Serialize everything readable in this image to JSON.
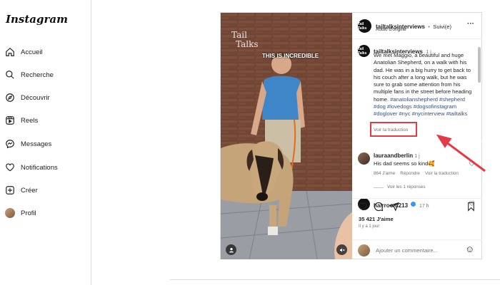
{
  "app": {
    "logo": "Instagram"
  },
  "nav": [
    {
      "label": "Accueil",
      "icon": "home-icon"
    },
    {
      "label": "Recherche",
      "icon": "search-icon"
    },
    {
      "label": "Découvrir",
      "icon": "compass-icon"
    },
    {
      "label": "Reels",
      "icon": "reels-icon"
    },
    {
      "label": "Messages",
      "icon": "messenger-icon"
    },
    {
      "label": "Notifications",
      "icon": "heart-icon"
    },
    {
      "label": "Créer",
      "icon": "plus-square-icon"
    },
    {
      "label": "Profil",
      "icon": "profile-avatar"
    }
  ],
  "media": {
    "watermark_line1": "Tail",
    "watermark_line2": "Talks",
    "overlay_text": "THIS IS INCREDIBLE"
  },
  "post_header": {
    "avatar_text": "Tail Talks",
    "username": "tailtalksinterviews",
    "separator": "•",
    "follow_status": "Suivi(e)",
    "audio": "Audio d'origine",
    "more": "···"
  },
  "caption": {
    "username": "tailtalksinterviews",
    "time": "1 j",
    "text": "We met Maggio, a beautiful and huge Anatolian Shepherd, on a walk with his dad. He was in a big hurry to get back to his couch after a long walk, but he was sure to grab some attention from his multiple fans in the street before heading home.",
    "hashtags": "#anatolianshepherd #shepherd #dog #lovedogs #dogsofinstagram #doglover #nyc #nycinterview #tailtalks",
    "translate": "Voir la traduction"
  },
  "comments": [
    {
      "username": "lauraandberlin",
      "time": "1 j",
      "text": "His dad seems so kind🥰",
      "likes": "864 J'aime",
      "reply": "Répondre",
      "translate": "Voir la traduction",
      "view_replies": "Voir les 1 réponses"
    },
    {
      "username": "hairroom213",
      "time": "17 h"
    }
  ],
  "actions": {
    "likes": "35 421 J'aime",
    "posted": "Il y a 1 jour",
    "comment_placeholder": "Ajouter un commentaire...",
    "emoji": "☺"
  },
  "colors": {
    "highlight": "#e53945",
    "link": "#385185",
    "verified": "#3897f0"
  }
}
